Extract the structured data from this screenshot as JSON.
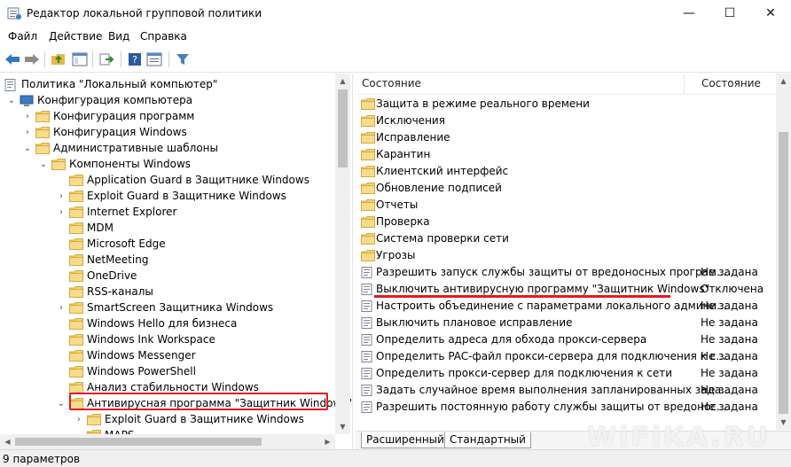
{
  "window": {
    "title": "Редактор локальной групповой политики",
    "minimize": "—",
    "maximize": "☐",
    "close": "✕"
  },
  "menu": [
    "Файл",
    "Действие",
    "Вид",
    "Справка"
  ],
  "tree": [
    {
      "label": "Политика \"Локальный компьютер\"",
      "level": 0,
      "expander": "",
      "icon": "policy"
    },
    {
      "label": "Конфигурация компьютера",
      "level": 1,
      "expander": "open",
      "icon": "computer"
    },
    {
      "label": "Конфигурация программ",
      "level": 2,
      "expander": "closed",
      "icon": "folder"
    },
    {
      "label": "Конфигурация Windows",
      "level": 2,
      "expander": "closed",
      "icon": "folder"
    },
    {
      "label": "Административные шаблоны",
      "level": 2,
      "expander": "open",
      "icon": "folder"
    },
    {
      "label": "Компоненты Windows",
      "level": 3,
      "expander": "open",
      "icon": "folder"
    },
    {
      "label": "Application Guard в Защитнике Windows",
      "level": 4,
      "expander": "",
      "icon": "folder"
    },
    {
      "label": "Exploit Guard в Защитнике Windows",
      "level": 4,
      "expander": "closed",
      "icon": "folder"
    },
    {
      "label": "Internet Explorer",
      "level": 4,
      "expander": "closed",
      "icon": "folder"
    },
    {
      "label": "MDM",
      "level": 4,
      "expander": "",
      "icon": "folder"
    },
    {
      "label": "Microsoft Edge",
      "level": 4,
      "expander": "",
      "icon": "folder"
    },
    {
      "label": "NetMeeting",
      "level": 4,
      "expander": "",
      "icon": "folder"
    },
    {
      "label": "OneDrive",
      "level": 4,
      "expander": "",
      "icon": "folder"
    },
    {
      "label": "RSS-каналы",
      "level": 4,
      "expander": "",
      "icon": "folder"
    },
    {
      "label": "SmartScreen Защитника Windows",
      "level": 4,
      "expander": "closed",
      "icon": "folder"
    },
    {
      "label": "Windows Hello для бизнеса",
      "level": 4,
      "expander": "",
      "icon": "folder"
    },
    {
      "label": "Windows Ink Workspace",
      "level": 4,
      "expander": "",
      "icon": "folder"
    },
    {
      "label": "Windows Messenger",
      "level": 4,
      "expander": "",
      "icon": "folder"
    },
    {
      "label": "Windows PowerShell",
      "level": 4,
      "expander": "",
      "icon": "folder"
    },
    {
      "label": "Анализ стабильности Windows",
      "level": 4,
      "expander": "",
      "icon": "folder"
    },
    {
      "label": "Антивирусная программа \"Защитник Windows\"",
      "level": 4,
      "expander": "open",
      "icon": "folder",
      "highlight": true
    },
    {
      "label": "Exploit Guard в Защитнике Windows",
      "level": 5,
      "expander": "closed",
      "icon": "folder"
    },
    {
      "label": "MAPS",
      "level": 5,
      "expander": "",
      "icon": "folder"
    }
  ],
  "list": {
    "columns": {
      "name": "Состояние",
      "state": "Состояние"
    },
    "rows": [
      {
        "name": "Защита в режиме реального времени",
        "state": "",
        "icon": "folder"
      },
      {
        "name": "Исключения",
        "state": "",
        "icon": "folder"
      },
      {
        "name": "Исправление",
        "state": "",
        "icon": "folder"
      },
      {
        "name": "Карантин",
        "state": "",
        "icon": "folder"
      },
      {
        "name": "Клиентский интерфейс",
        "state": "",
        "icon": "folder"
      },
      {
        "name": "Обновление подписей",
        "state": "",
        "icon": "folder"
      },
      {
        "name": "Отчеты",
        "state": "",
        "icon": "folder"
      },
      {
        "name": "Проверка",
        "state": "",
        "icon": "folder"
      },
      {
        "name": "Система проверки сети",
        "state": "",
        "icon": "folder"
      },
      {
        "name": "Угрозы",
        "state": "",
        "icon": "folder"
      },
      {
        "name": "Разрешить запуск службы защиты от вредоносных програм...",
        "state": "Не задана",
        "icon": "setting"
      },
      {
        "name": "Выключить антивирусную программу \"Защитник Windows\"",
        "state": "Отключена",
        "icon": "setting",
        "underline": true
      },
      {
        "name": "Настроить объединение с параметрами локального админи...",
        "state": "Не задана",
        "icon": "setting"
      },
      {
        "name": "Выключить плановое исправление",
        "state": "Не задана",
        "icon": "setting"
      },
      {
        "name": "Определить адреса для обхода прокси-сервера",
        "state": "Не задана",
        "icon": "setting"
      },
      {
        "name": "Определить PAC-файл прокси-сервера для подключения к с...",
        "state": "Не задана",
        "icon": "setting"
      },
      {
        "name": "Определить прокси-сервер для подключения к сети",
        "state": "Не задана",
        "icon": "setting"
      },
      {
        "name": "Задать случайное время выполнения запланированных зада...",
        "state": "Не задана",
        "icon": "setting"
      },
      {
        "name": "Разрешить постоянную работу службы защиты от вредонос...",
        "state": "Не задана",
        "icon": "setting"
      }
    ]
  },
  "tabs": [
    "Расширенный",
    "Стандартный"
  ],
  "status": "9 параметров",
  "watermark": "WiFiKA.RU",
  "colors": {
    "highlight": "#e21b23",
    "folder": "#e8b84a",
    "toolbar_arrow": "#2f79c2"
  }
}
